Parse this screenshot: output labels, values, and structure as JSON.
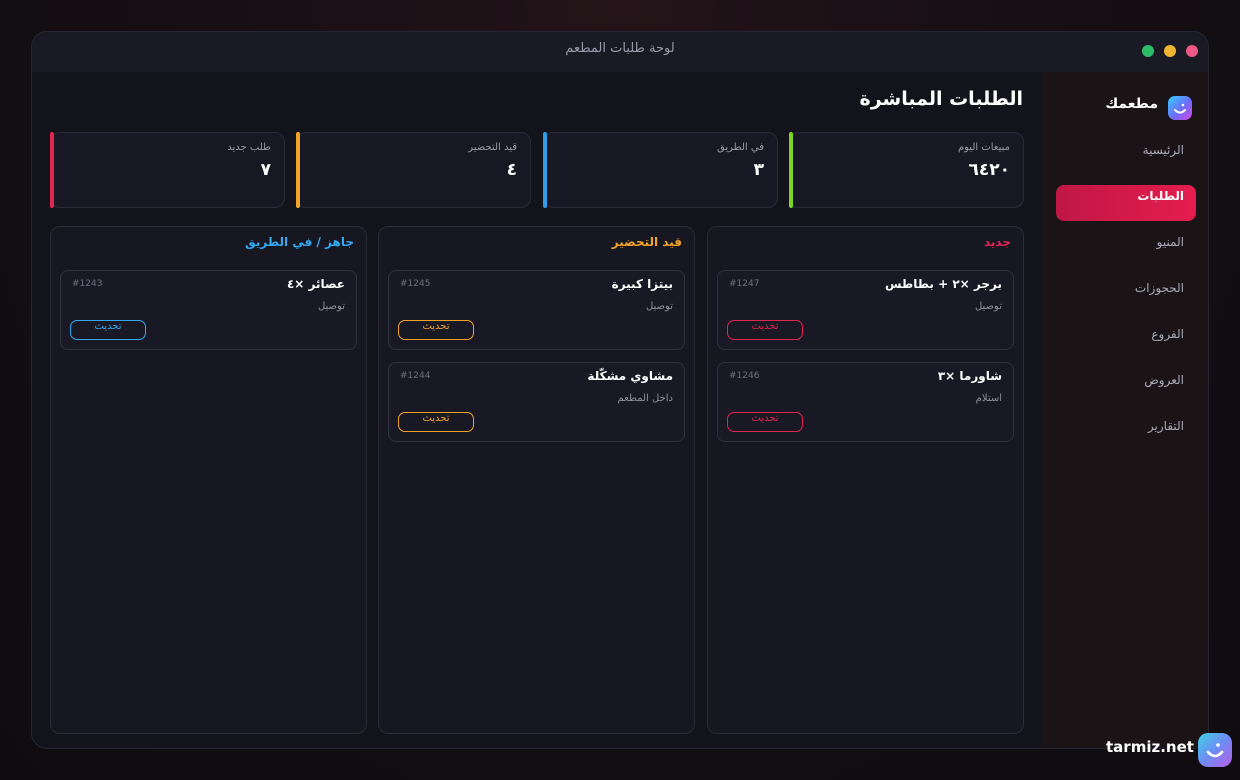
{
  "window": {
    "title": "لوحة طلبات المطعم"
  },
  "sidebar": {
    "brand": "مطعمك",
    "items": [
      {
        "label": "الرئيسية",
        "active": false
      },
      {
        "label": "الطلبات",
        "active": true
      },
      {
        "label": "المنيو",
        "active": false
      },
      {
        "label": "الحجوزات",
        "active": false
      },
      {
        "label": "الفروع",
        "active": false
      },
      {
        "label": "العروض",
        "active": false
      },
      {
        "label": "التقارير",
        "active": false
      }
    ]
  },
  "main": {
    "title": "الطلبات المباشرة",
    "stats": [
      {
        "label": "مبيعات اليوم",
        "value": "٦٤٢٠",
        "color": "#7ed321"
      },
      {
        "label": "في الطريق",
        "value": "٣",
        "color": "#2f9de8"
      },
      {
        "label": "قيد التحضير",
        "value": "٤",
        "color": "#f2a32a"
      },
      {
        "label": "طلب جديد",
        "value": "٧",
        "color": "#e0254f"
      }
    ],
    "columns": [
      {
        "title": "جديد",
        "color": "#e0254f",
        "orders": [
          {
            "title": "برجر ×٢ + بطاطس",
            "id": "#1247",
            "type": "توصيل",
            "button": "تحديث"
          },
          {
            "title": "شاورما ×٣",
            "id": "#1246",
            "type": "استلام",
            "button": "تحديث"
          }
        ]
      },
      {
        "title": "قيد التحضير",
        "color": "#f2a32a",
        "orders": [
          {
            "title": "بيتزا كبيرة",
            "id": "#1245",
            "type": "توصيل",
            "button": "تحديث"
          },
          {
            "title": "مشاوي مشكّلة",
            "id": "#1244",
            "type": "داخل المطعم",
            "button": "تحديث"
          }
        ]
      },
      {
        "title": "جاهز / في الطريق",
        "color": "#34a9f0",
        "orders": [
          {
            "title": "عصائر ×٤",
            "id": "#1243",
            "type": "توصيل",
            "button": "تحديث"
          }
        ]
      }
    ]
  },
  "watermark": {
    "text": "tarmiz.net"
  }
}
